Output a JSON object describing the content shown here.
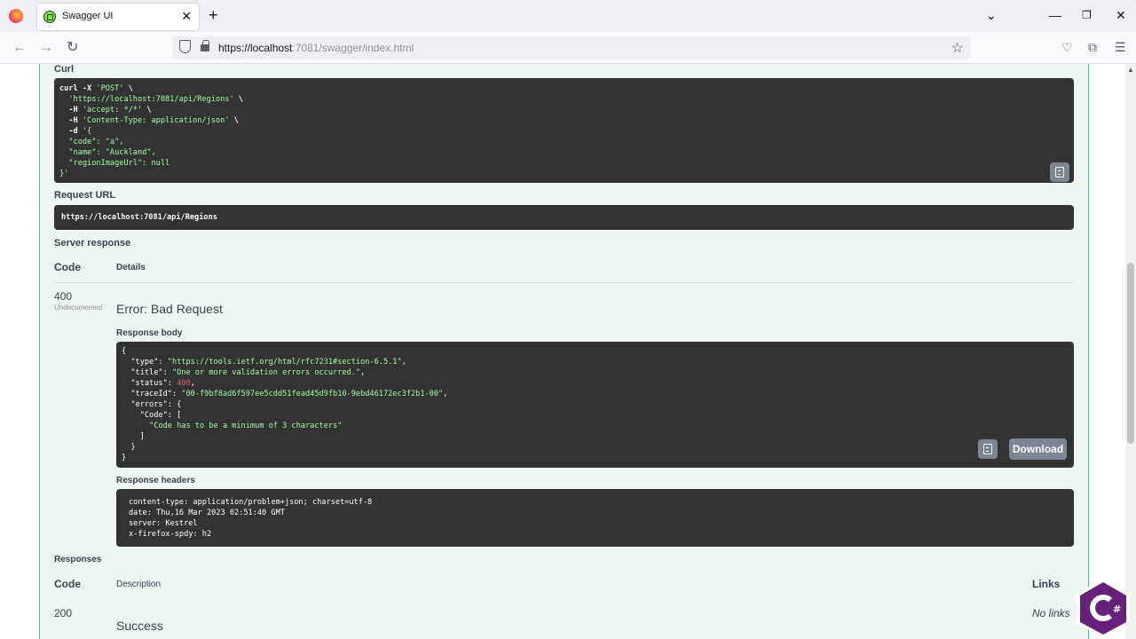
{
  "browser": {
    "tab_title": "Swagger UI",
    "url_host": "https://localhost",
    "url_rest": ":7081/swagger/index.html"
  },
  "curl": {
    "label": "Curl",
    "lines": [
      [
        "curl -X ",
        "'POST'",
        " \\"
      ],
      [
        "  ",
        "'https://localhost:7081/api/Regions'",
        " \\"
      ],
      [
        "  -H ",
        "'accept: */*'",
        " \\"
      ],
      [
        "  -H ",
        "'Content-Type: application/json'",
        " \\"
      ],
      [
        "  -d ",
        "'{",
        ""
      ],
      [
        "  ",
        "\"code\": \"a\",",
        ""
      ],
      [
        "  ",
        "\"name\": \"Auckland\",",
        ""
      ],
      [
        "  ",
        "\"regionImageUrl\": null",
        ""
      ],
      [
        "",
        "}'",
        ""
      ]
    ]
  },
  "request_url": {
    "label": "Request URL",
    "value": "https://localhost:7081/api/Regions"
  },
  "server_response": {
    "label": "Server response",
    "col_code": "Code",
    "col_details": "Details",
    "status_code": "400",
    "undocumented": "Undocumented",
    "error_title": "Error: Bad Request",
    "body_label": "Response body",
    "body_lines": [
      "{",
      "  \"type\": \"https://tools.ietf.org/html/rfc7231#section-6.5.1\",",
      "  \"title\": \"One or more validation errors occurred.\",",
      "  \"status\": 400,",
      "  \"traceId\": \"00-f9bf8ad6f597ee5cdd51fead45d9fb10-9ebd46172ec3f2b1-00\",",
      "  \"errors\": {",
      "    \"Code\": [",
      "      \"Code has to be a minimum of 3 characters\"",
      "    ]",
      "  }",
      "}"
    ],
    "download_label": "Download",
    "headers_label": "Response headers",
    "header_lines": [
      "content-type: application/problem+json; charset=utf-8",
      "date: Thu,16 Mar 2023 02:51:40 GMT",
      "server: Kestrel",
      "x-firefox-spdy: h2"
    ]
  },
  "responses": {
    "label": "Responses",
    "col_code": "Code",
    "col_description": "Description",
    "col_links": "Links",
    "rows": [
      {
        "code": "200",
        "description": "Success",
        "links": "No links"
      }
    ]
  },
  "colors": {
    "post_green": "#49cc90",
    "block_bg": "#eef6f1",
    "code_bg": "#333333",
    "string_green": "#a2fca2",
    "number_red": "#d36363"
  }
}
